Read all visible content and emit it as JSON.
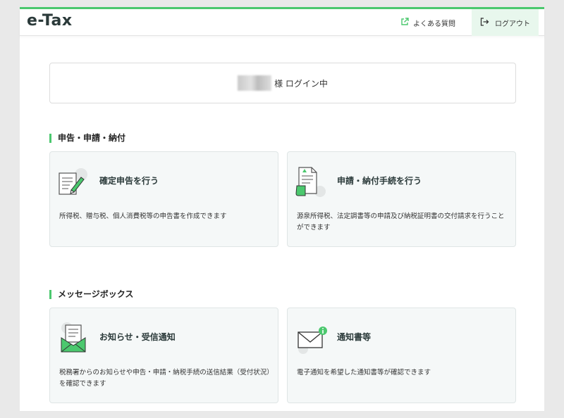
{
  "header": {
    "logo": "e-Tax",
    "faq_label": "よくある質問",
    "logout_label": "ログアウト"
  },
  "login_status": "様 ログイン中",
  "sections": [
    {
      "title": "申告・申請・納付",
      "cards": [
        {
          "title": "確定申告を行う",
          "description": "所得税、贈与税、個人消費税等の申告書を作成できます",
          "icon": "document-pen-icon"
        },
        {
          "title": "申請・納付手続を行う",
          "description": "源泉所得税、法定調書等の申請及び納税証明書の交付請求を行うことができます",
          "icon": "application-document-icon"
        }
      ]
    },
    {
      "title": "メッセージボックス",
      "cards": [
        {
          "title": "お知らせ・受信通知",
          "description": "税務署からのお知らせや申告・申請・納税手続の送信結果（受付状況）を確認できます",
          "icon": "open-envelope-icon"
        },
        {
          "title": "通知書等",
          "description": "電子通知を希望した通知書等が確認できます",
          "icon": "envelope-info-icon"
        }
      ]
    }
  ],
  "colors": {
    "accent": "#4bc86e",
    "card_bg": "#f5f8f8",
    "logout_bg": "#e8f7ed"
  }
}
